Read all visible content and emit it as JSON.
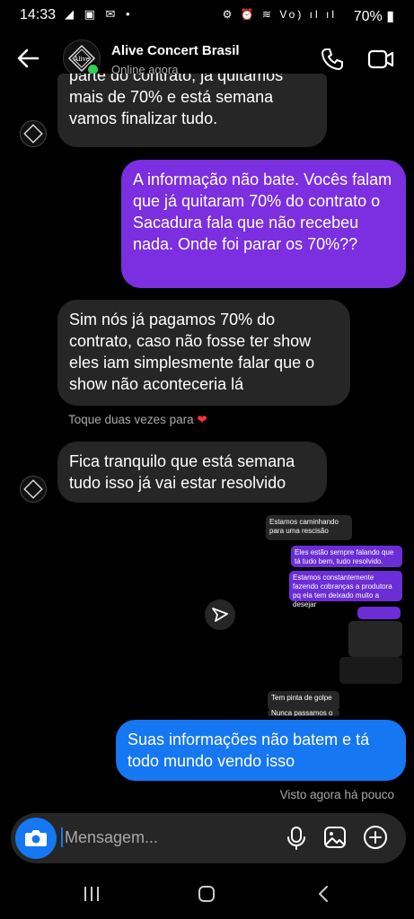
{
  "status_bar": {
    "time": "14:33",
    "left_icons": "◢ ▣ ✉ •",
    "right_icons": "⚙ ⏰ ≋ Vo) ıl ıl",
    "battery": "70%"
  },
  "header": {
    "contact_name": "Alive Concert Brasil",
    "contact_status": "Online agora",
    "avatar_text": "Alive"
  },
  "messages": [
    {
      "from": "them",
      "text": "parte do contrato, já quitamos mais de 70% e está semana vamos finalizar tudo."
    },
    {
      "from": "me",
      "text": "A informação não bate. Vocês falam que já quitaram 70% do contrato o Sacadura fala que não recebeu nada. Onde foi parar os 70%??"
    },
    {
      "from": "them",
      "text": "Sim nós já pagamos 70% do contrato, caso não fosse ter show eles iam simplesmente falar que o show não aconteceria lá"
    },
    {
      "from": "them",
      "text": "Fica tranquilo que está semana tudo isso já vai estar resolvido"
    },
    {
      "from": "me",
      "text": "Suas informações não batem e tá todo mundo vendo isso"
    }
  ],
  "reaction_hint": "Toque duas vezes para",
  "seen_text": "Visto agora há pouco",
  "screenshot": {
    "m1": "Estamos caminhando para uma rescisão",
    "m2": "Eles estão sempre falando que tá tudo bem, tudo resolvido.",
    "m3": "Estamos constantemente fazendo cobranças a produtora pq ela tem deixado muito a desejar",
    "m4": "Tem pinta de golpe",
    "m5": "Nunca passamos o tanta"
  },
  "composer": {
    "placeholder": "Mensagem..."
  },
  "colors": {
    "purple": "#7b2fe0",
    "blue": "#1677f2",
    "incoming": "#262626",
    "online": "#2fd158"
  },
  "icons": [
    "back-arrow-icon",
    "phone-icon",
    "video-icon",
    "camera-icon",
    "mic-icon",
    "gallery-icon",
    "plus-icon",
    "share-icon",
    "heart-icon"
  ]
}
